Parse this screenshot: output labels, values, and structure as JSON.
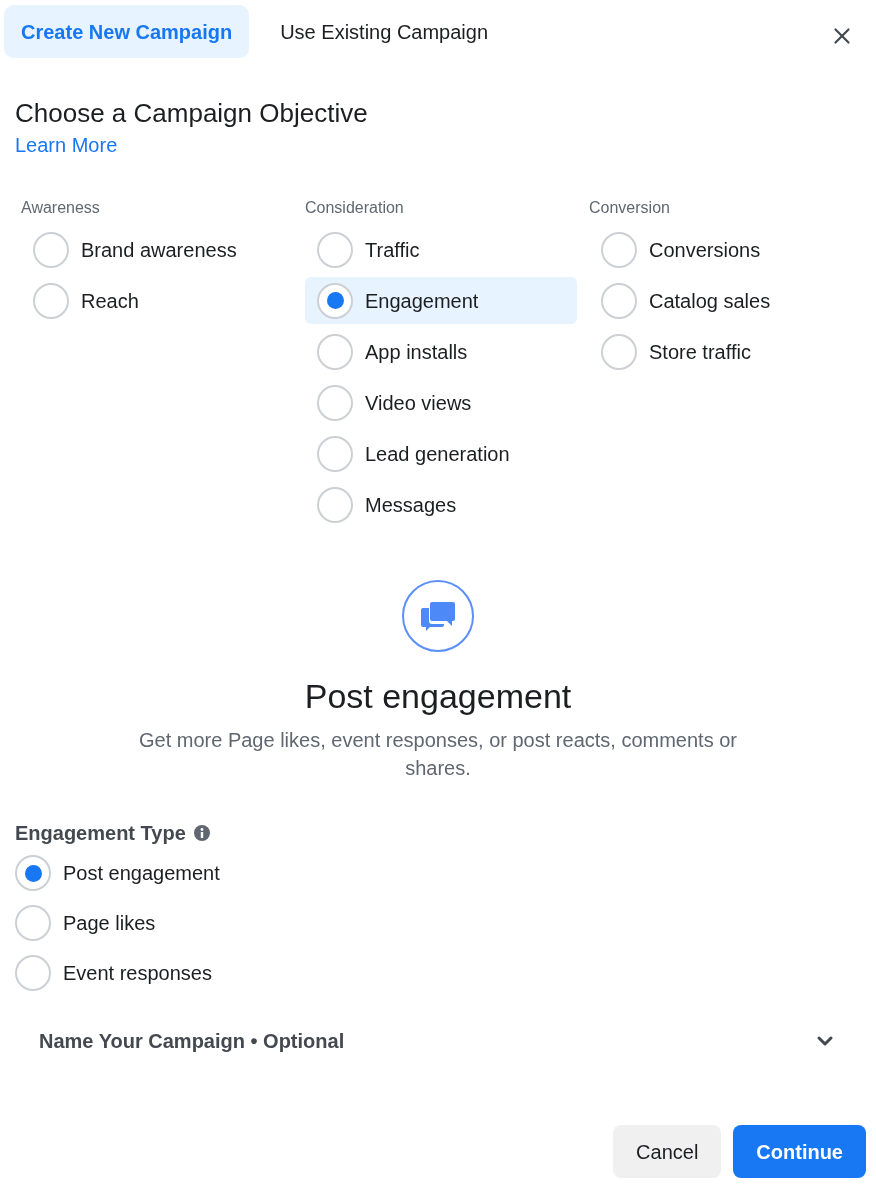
{
  "tabs": [
    {
      "label": "Create New Campaign",
      "selected": true
    },
    {
      "label": "Use Existing Campaign",
      "selected": false
    }
  ],
  "heading": "Choose a Campaign Objective",
  "learn_more_link": "Learn More",
  "objective_groups": [
    {
      "title": "Awareness",
      "options": [
        {
          "label": "Brand awareness",
          "selected": false
        },
        {
          "label": "Reach",
          "selected": false
        }
      ]
    },
    {
      "title": "Consideration",
      "options": [
        {
          "label": "Traffic",
          "selected": false
        },
        {
          "label": "Engagement",
          "selected": true
        },
        {
          "label": "App installs",
          "selected": false
        },
        {
          "label": "Video views",
          "selected": false
        },
        {
          "label": "Lead generation",
          "selected": false
        },
        {
          "label": "Messages",
          "selected": false
        }
      ]
    },
    {
      "title": "Conversion",
      "options": [
        {
          "label": "Conversions",
          "selected": false
        },
        {
          "label": "Catalog sales",
          "selected": false
        },
        {
          "label": "Store traffic",
          "selected": false
        }
      ]
    }
  ],
  "objective_detail": {
    "title": "Post engagement",
    "description": "Get more Page likes, event responses, or post reacts, comments or shares."
  },
  "engagement_type": {
    "label": "Engagement Type",
    "options": [
      {
        "label": "Post engagement",
        "selected": true
      },
      {
        "label": "Page likes",
        "selected": false
      },
      {
        "label": "Event responses",
        "selected": false
      }
    ]
  },
  "name_section": {
    "label": "Name Your Campaign • Optional",
    "expanded": false
  },
  "buttons": [
    {
      "label": "Cancel",
      "kind": "secondary"
    },
    {
      "label": "Continue",
      "kind": "primary"
    }
  ]
}
